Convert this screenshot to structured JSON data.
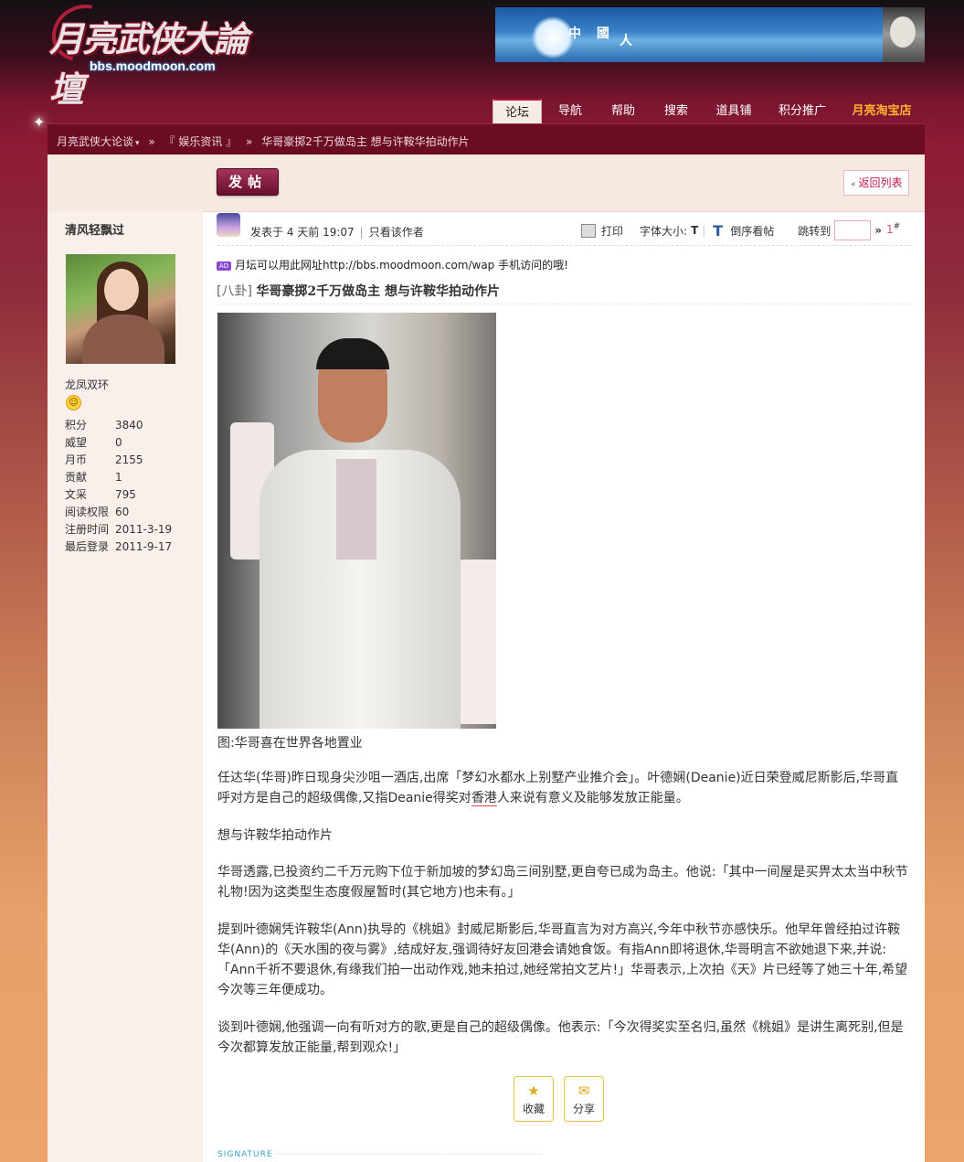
{
  "header": {
    "logo_main": "月亮武侠大論壇",
    "logo_url": "bbs.moodmoon.com",
    "banner_text_1": "中 國",
    "banner_text_2": "人"
  },
  "nav": {
    "items": [
      {
        "label": "论坛",
        "active": true
      },
      {
        "label": "导航"
      },
      {
        "label": "帮助"
      },
      {
        "label": "搜索"
      },
      {
        "label": "道具铺"
      },
      {
        "label": "积分推广"
      },
      {
        "label": "月亮淘宝店",
        "highlight": "#ffb22e"
      }
    ]
  },
  "breadcrumb": {
    "home": "月亮武侠大论谈",
    "sep": "»",
    "forum": "『 娱乐资讯 』",
    "current": "华哥豪掷2千万做岛主 想与许鞍华拍动作片"
  },
  "toolbar": {
    "post_label": "发帖",
    "back_label": "返回列表"
  },
  "author": {
    "name": "清风轻飘过",
    "rank": "龙凤双环",
    "stats": [
      {
        "k": "积分",
        "v": "3840"
      },
      {
        "k": "威望",
        "v": "0"
      },
      {
        "k": "月币",
        "v": "2155"
      },
      {
        "k": "贡献",
        "v": "1"
      },
      {
        "k": "文采",
        "v": "795"
      },
      {
        "k": "阅读权限",
        "v": "60"
      },
      {
        "k": "注册时间",
        "v": "2011-3-19"
      },
      {
        "k": "最后登录",
        "v": "2011-9-17"
      }
    ]
  },
  "post": {
    "posted": "发表于 4 天前 19:07",
    "sep": "|",
    "only_author": "只看该作者",
    "print": "打印",
    "font_size": "字体大小:",
    "font_t": "T",
    "font_T": "T",
    "reverse": "倒序看帖",
    "jump": "跳转到",
    "jump_arrow": "»",
    "floor": "1",
    "floor_mark": "#",
    "ad_badge": "AD",
    "ad_text": "月坛可以用此网址http://bbs.moodmoon.com/wap   手机访问的哦!",
    "category": "[八卦]",
    "title": "华哥豪掷2千万做岛主 想与许鞍华拍动作片",
    "caption": "图:华哥喜在世界各地置业",
    "p1_a": "任达华(华哥)昨日现身尖沙咀一酒店,出席「梦幻水都水上别墅产业推介会」。叶德娴(Deanie)近日荣登威尼斯影后,华哥直呼对方是自己的超级偶像,又指Deanie得奖对",
    "p1_u": "香港",
    "p1_b": "人来说有意义及能够发放正能量。",
    "p2": "想与许鞍华拍动作片",
    "p3": "华哥透露,已投资约二千万元购下位于新加坡的梦幻岛三间别墅,更自夸已成为岛主。他说:「其中一间屋是买畀太太当中秋节礼物!因为这类型生态度假屋暂时(其它地方)也未有。」",
    "p4": "提到叶德娴凭许鞍华(Ann)执导的《桃姐》封威尼斯影后,华哥直言为对方高兴,今年中秋节亦感快乐。他早年曾经拍过许鞍华(Ann)的《天水围的夜与雾》,结成好友,强调待好友回港会请她食饭。有指Ann即将退休,华哥明言不欲她退下来,并说:「Ann千祈不要退休,有缘我们拍一出动作戏,她未拍过,她经常拍文艺片!」华哥表示,上次拍《天》片已经等了她三十年,希望今次等三年便成功。",
    "p5": "谈到叶德娴,他强调一向有听对方的歌,更是自己的超级偶像。他表示:「今次得奖实至名归,虽然《桃姐》是讲生离死别,但是今次都算发放正能量,帮到观众!」",
    "fav": "收藏",
    "share": "分享",
    "signature": "SIGNATURE"
  }
}
